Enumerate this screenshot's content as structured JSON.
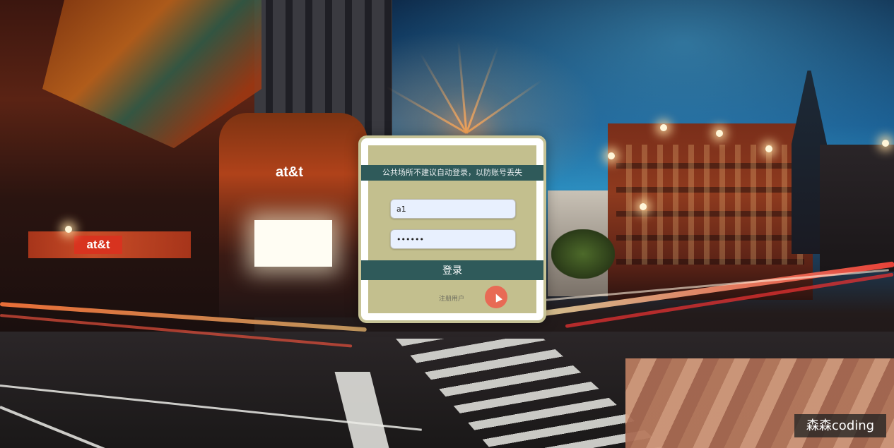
{
  "login": {
    "notice": "公共场所不建议自动登录，以防账号丢失",
    "username_value": "a1",
    "password_value": "••••••",
    "submit_label": "登录",
    "register_label": "注册用户"
  },
  "background": {
    "sign_text_1": "at&t",
    "sign_text_2": "at&t"
  },
  "watermark": {
    "text": "森森coding"
  },
  "colors": {
    "accent": "#2f5a5a",
    "card_fill": "#c3bf8e",
    "card_border": "#c7c396",
    "cursor_highlight": "#e86a55"
  }
}
